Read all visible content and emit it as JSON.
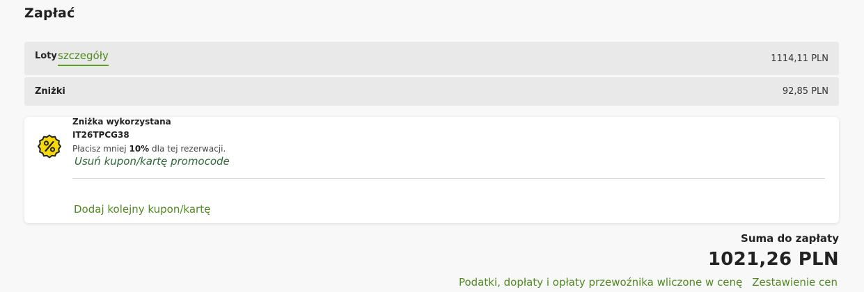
{
  "page": {
    "title": "Zapłać"
  },
  "summary": {
    "flights": {
      "label": "Loty",
      "details_link": "szczegóły",
      "value": "1114,11 PLN"
    },
    "discounts": {
      "label": "Zniżki",
      "value": "92,85 PLN"
    }
  },
  "coupon": {
    "icon": "percent-badge-icon",
    "icon_color": "#f5d90a",
    "title": "Zniżka wykorzystana",
    "code": "IT26TPCG38",
    "desc_prefix": "Płacisz mniej ",
    "desc_percent": "10%",
    "desc_suffix": " dla tej rezerwacji.",
    "remove_link": "Usuń kupon/kartę promocode",
    "add_link": "Dodaj kolejny kupon/kartę"
  },
  "total": {
    "label": "Suma do zapłaty",
    "value": "1021,26 PLN",
    "taxes_note": "Podatki, dopłaty i opłaty przewoźnika wliczone w cenę",
    "breakdown_link": "Zestawienie cen"
  },
  "colors": {
    "accent_green": "#4f8a1e",
    "dark_green": "#2d6a38",
    "row_bg": "#e9e9e9"
  }
}
